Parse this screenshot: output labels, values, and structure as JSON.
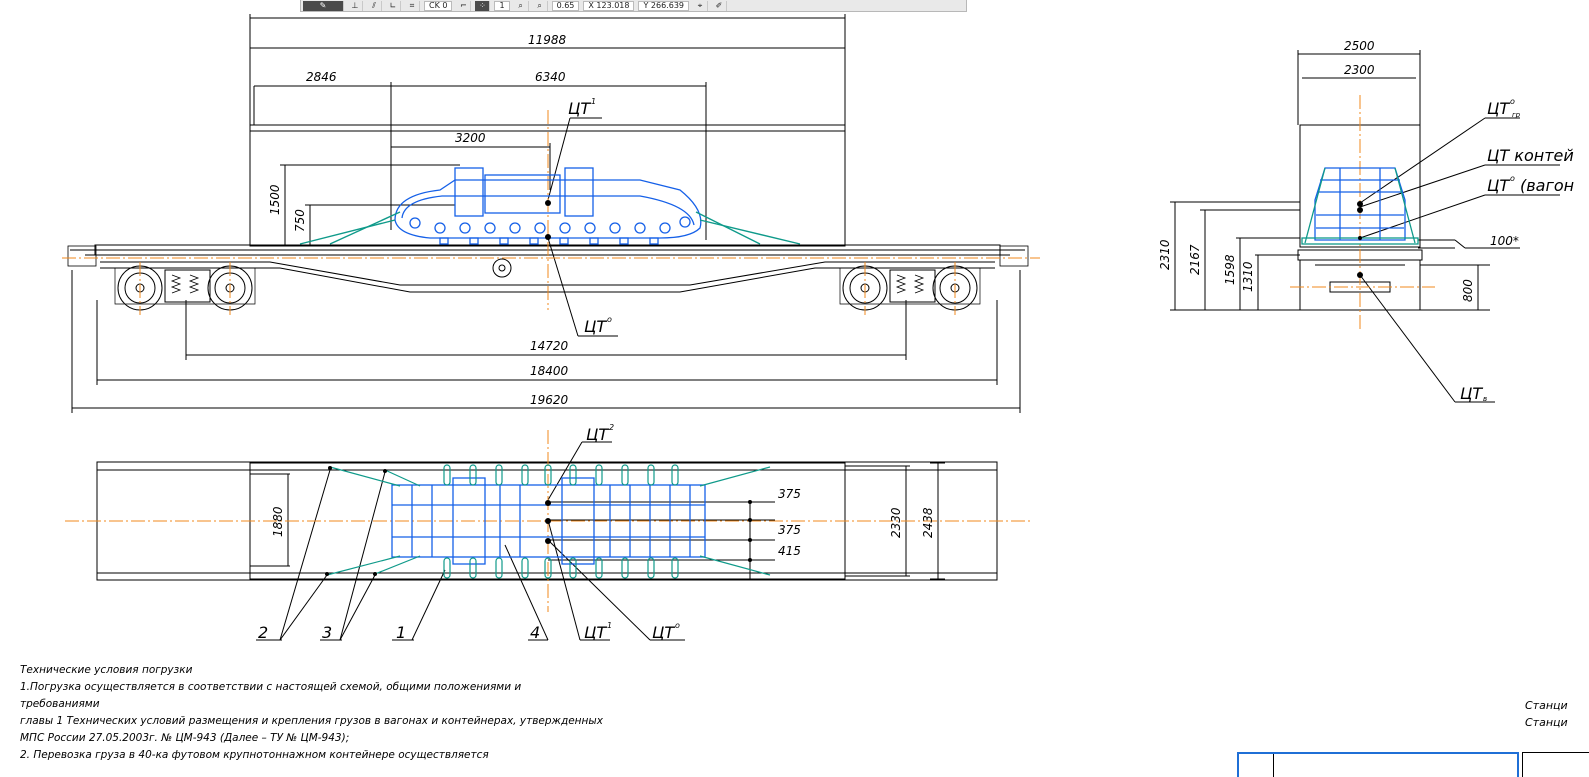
{
  "toolbar": {
    "field_1": "CK 0",
    "field_2": "1",
    "zoom": "0.65",
    "coord_x": "X 123.018",
    "coord_y": "Y 266.639"
  },
  "side_view": {
    "dims": [
      "11988",
      "2846",
      "6340",
      "3200",
      "1500",
      "750",
      "14720",
      "18400",
      "19620"
    ],
    "labels": [
      "ЦТ",
      "ЦТ"
    ],
    "label_sup": [
      "1",
      "о"
    ]
  },
  "end_view": {
    "dims": [
      "2500",
      "2300",
      "2310",
      "2167",
      "1598",
      "1310",
      "800",
      "100*"
    ],
    "labels": [
      "ЦТ",
      "ЦТ контей",
      "ЦТ",
      "(вагон",
      "ЦТ"
    ],
    "label_sup": [
      "о",
      "о",
      "о"
    ],
    "label_sub": [
      "гр",
      "в"
    ]
  },
  "plan_view": {
    "dims": [
      "1880",
      "2330",
      "2438",
      "375",
      "375",
      "415"
    ],
    "labels": [
      "ЦТ",
      "ЦТ",
      "ЦТ"
    ],
    "label_sup": [
      "2",
      "1",
      "о"
    ],
    "callouts": [
      "2",
      "3",
      "1",
      "4"
    ]
  },
  "notes": [
    "Технические условия погрузки",
    "1.Погрузка осуществляется в соответствии с настоящей схемой, общими положениями и",
    "требованиями",
    "главы 1 Технических условий размещения и крепления грузов в вагонах и контейнерах, утвержденных",
    "МПС России 27.05.2003г. № ЦМ-943 (Далее – ТУ № ЦМ-943);",
    "2. Перевозка груза в 40-ка футовом крупнотоннажном контейнере осуществляется"
  ],
  "stations": [
    "Станци",
    "Станци"
  ],
  "colors": {
    "line": "#000000",
    "cargo": "#1560e8",
    "strap": "#0f9a8a",
    "axis": "#f08a1c",
    "stamp": "#1f6fd6"
  }
}
